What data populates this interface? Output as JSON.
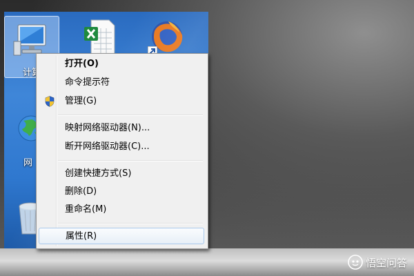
{
  "desktop": {
    "icons": [
      {
        "name": "computer",
        "label": "计算"
      },
      {
        "name": "excel",
        "label": ""
      },
      {
        "name": "firefox",
        "label": ""
      },
      {
        "name": "network",
        "label": "网"
      },
      {
        "name": "recycle-bin",
        "label": ""
      }
    ]
  },
  "context_menu": {
    "items": [
      {
        "label": "打开(O)",
        "bold": true
      },
      {
        "label": "命令提示符"
      },
      {
        "label": "管理(G)",
        "icon": "uac-shield-icon"
      },
      {
        "label": "映射网络驱动器(N)..."
      },
      {
        "label": "断开网络驱动器(C)..."
      },
      {
        "label": "创建快捷方式(S)"
      },
      {
        "label": "删除(D)"
      },
      {
        "label": "重命名(M)"
      },
      {
        "label": "属性(R)",
        "highlighted": true
      }
    ]
  },
  "watermark": {
    "text": "悟空问答"
  },
  "colors": {
    "desktop": "#3f86d8",
    "menu_bg": "#f0f0f0",
    "highlight_border": "#a8c8eb"
  }
}
